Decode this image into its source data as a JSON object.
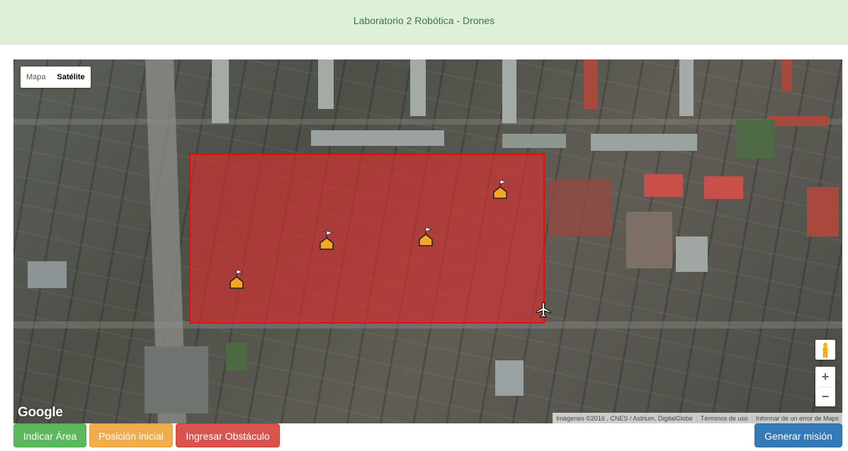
{
  "header": {
    "title": "Laboratorio 2 Robótica - Drones"
  },
  "map": {
    "type_control": {
      "options": [
        "Mapa",
        "Satélite"
      ],
      "selected": "Satélite"
    },
    "logo": "Google",
    "attribution": {
      "imagery": "Imágenes ©2016 , CNES / Astrium, DigitalGlobe",
      "terms": "Términos de uso",
      "report": "Informar de un error de Maps"
    },
    "zoom": {
      "in": "+",
      "out": "−"
    },
    "area_color": "#e02d2d",
    "marker_icon": "flag-house-icon",
    "drone_icon": "airplane-icon"
  },
  "actions": {
    "indicar_area": "Indicar Área",
    "posicion_inicial": "Posición inicial",
    "ingresar_obstaculo": "Ingresar Obstáculo",
    "generar_mision": "Generar misión"
  },
  "colors": {
    "success": "#5cb85c",
    "warning": "#f0ad4e",
    "danger": "#d9534f",
    "primary": "#337ab7",
    "header_bg": "#dff0d8",
    "header_text": "#3c763d"
  }
}
